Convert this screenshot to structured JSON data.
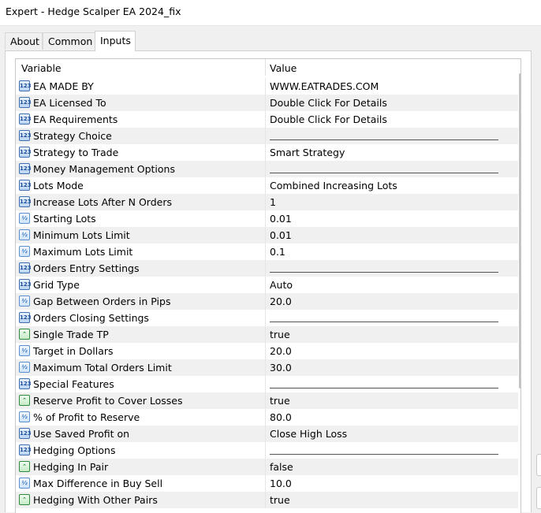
{
  "window": {
    "title": "Expert - Hedge Scalper EA 2024_fix"
  },
  "tabs": [
    {
      "label": "About"
    },
    {
      "label": "Common"
    },
    {
      "label": "Inputs"
    }
  ],
  "grid": {
    "columns": {
      "variable": "Variable",
      "value": "Value"
    },
    "rows": [
      {
        "name": "EA MADE BY",
        "value": "WWW.EATRADES.COM",
        "icon": "int-param-icon"
      },
      {
        "name": "EA Licensed To",
        "value": "Double Click For Details",
        "icon": "int-param-icon"
      },
      {
        "name": "EA Requirements",
        "value": "Double Click For Details",
        "icon": "int-param-icon"
      },
      {
        "name": "Strategy Choice",
        "value": "",
        "icon": "int-param-icon",
        "separator": true
      },
      {
        "name": "Strategy to Trade",
        "value": "Smart Strategy",
        "icon": "int-param-icon"
      },
      {
        "name": "Money Management Options",
        "value": "",
        "icon": "int-param-icon",
        "separator": true
      },
      {
        "name": "Lots Mode",
        "value": "Combined Increasing Lots",
        "icon": "int-param-icon"
      },
      {
        "name": "Increase Lots After N Orders",
        "value": "1",
        "icon": "int-param-icon"
      },
      {
        "name": "Starting Lots",
        "value": "0.01",
        "icon": "double-param-icon"
      },
      {
        "name": "Minimum Lots Limit",
        "value": "0.01",
        "icon": "double-param-icon"
      },
      {
        "name": "Maximum Lots Limit",
        "value": "0.1",
        "icon": "double-param-icon"
      },
      {
        "name": "Orders Entry Settings",
        "value": "",
        "icon": "int-param-icon",
        "separator": true
      },
      {
        "name": "Grid Type",
        "value": "Auto",
        "icon": "int-param-icon"
      },
      {
        "name": "Gap Between Orders in Pips",
        "value": "20.0",
        "icon": "double-param-icon"
      },
      {
        "name": "Orders Closing Settings",
        "value": "",
        "icon": "int-param-icon",
        "separator": true
      },
      {
        "name": "Single Trade TP",
        "value": "true",
        "icon": "bool-param-icon"
      },
      {
        "name": "Target in Dollars",
        "value": "20.0",
        "icon": "double-param-icon"
      },
      {
        "name": "Maximum Total Orders Limit",
        "value": "30.0",
        "icon": "double-param-icon"
      },
      {
        "name": "Special Features",
        "value": "",
        "icon": "int-param-icon",
        "separator": true
      },
      {
        "name": "Reserve Profit to Cover Losses",
        "value": "true",
        "icon": "bool-param-icon"
      },
      {
        "name": "% of Profit to Reserve",
        "value": "80.0",
        "icon": "double-param-icon"
      },
      {
        "name": "Use Saved Profit on",
        "value": "Close High Loss",
        "icon": "int-param-icon"
      },
      {
        "name": "Hedging Options",
        "value": "",
        "icon": "int-param-icon",
        "separator": true
      },
      {
        "name": "Hedging In Pair",
        "value": "false",
        "icon": "bool-param-icon"
      },
      {
        "name": "Max Difference in Buy Sell",
        "value": "10.0",
        "icon": "double-param-icon"
      },
      {
        "name": "Hedging With Other Pairs",
        "value": "true",
        "icon": "bool-param-icon"
      }
    ]
  }
}
